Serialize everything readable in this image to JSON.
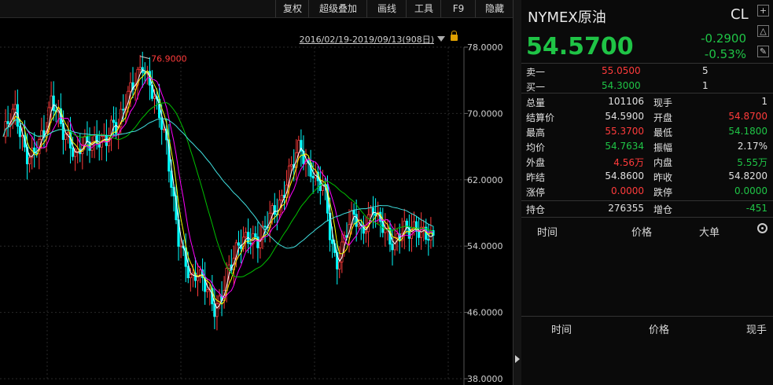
{
  "toolbar": {
    "items": [
      "复权",
      "超级叠加",
      "画线",
      "工具",
      "F9",
      "隐藏"
    ]
  },
  "range_label": "2016/02/19-2019/09/13(908日)",
  "quote": {
    "name": "NYMEX原油",
    "code": "CL",
    "price": "54.5700",
    "change": "-0.2900",
    "change_pct": "-0.53%",
    "orderbook": [
      {
        "label": "卖一",
        "price": "55.0500",
        "qty": "5",
        "color": "red"
      },
      {
        "label": "买一",
        "price": "54.3000",
        "qty": "1",
        "color": "green"
      }
    ],
    "stats": [
      {
        "l1": "总量",
        "v1": "101106",
        "c1": "white",
        "l2": "现手",
        "v2": "1",
        "c2": "white"
      },
      {
        "l1": "结算价",
        "v1": "54.5900",
        "c1": "white",
        "l2": "开盘",
        "v2": "54.8700",
        "c2": "red"
      },
      {
        "l1": "最高",
        "v1": "55.3700",
        "c1": "red",
        "l2": "最低",
        "v2": "54.1800",
        "c2": "green"
      },
      {
        "l1": "均价",
        "v1": "54.7634",
        "c1": "green",
        "l2": "振幅",
        "v2": "2.17%",
        "c2": "white"
      },
      {
        "l1": "外盘",
        "v1": "4.56万",
        "c1": "red",
        "l2": "内盘",
        "v2": "5.55万",
        "c2": "green"
      },
      {
        "l1": "昨结",
        "v1": "54.8600",
        "c1": "white",
        "l2": "昨收",
        "v2": "54.8200",
        "c2": "white"
      },
      {
        "l1": "涨停",
        "v1": "0.0000",
        "c1": "red",
        "l2": "跌停",
        "v2": "0.0000",
        "c2": "green"
      }
    ],
    "oi": {
      "l1": "持仓",
      "v1": "276355",
      "l2": "增仓",
      "v2": "-451"
    },
    "ticks_header": {
      "time": "时间",
      "price": "价格",
      "big": "大单"
    },
    "trades_header": {
      "time": "时间",
      "price": "价格",
      "qty": "现手"
    }
  },
  "chart_data": {
    "type": "candlestick",
    "title": "",
    "ylim": [
      38,
      78
    ],
    "y_ticks": [
      "78.0000",
      "70.0000",
      "62.0000",
      "54.0000",
      "46.0000",
      "38.0000"
    ],
    "annotation": "76.9000",
    "close_series": [
      67.2,
      68.8,
      70.1,
      67.5,
      65.2,
      64.8,
      66.0,
      67.9,
      72.5,
      70.3,
      67.1,
      65.9,
      64.8,
      67.2,
      66.5,
      65.8,
      66.4,
      67.1,
      69.3,
      68.2,
      70.4,
      72.8,
      74.9,
      76.2,
      73.4,
      71.2,
      69.5,
      66.8,
      60.2,
      54.1,
      51.8,
      50.2,
      51.5,
      49.8,
      47.6,
      45.9,
      48.3,
      51.4,
      52.2,
      53.8,
      54.9,
      55.6,
      54.8,
      55.2,
      57.3,
      58.6,
      60.1,
      62.4,
      63.8,
      65.9,
      64.2,
      63.5,
      61.3,
      60.8,
      55.2,
      52.1,
      54.3,
      56.2,
      57.4,
      55.8,
      57.2,
      58.9,
      56.4,
      55.8,
      54.7,
      55.3,
      56.1,
      55.2,
      55.9,
      56.4,
      55.8,
      54.57
    ]
  },
  "colors": {
    "up": "#ff3b3b",
    "down": "#00ffff",
    "ma5": "#ffffff",
    "ma10": "#ffff00",
    "ma20": "#ff00ff",
    "ma60": "#00c000",
    "ma120": "#40e0e0",
    "grid": "#2a2a2a",
    "axis_text": "#d0d0d0"
  }
}
